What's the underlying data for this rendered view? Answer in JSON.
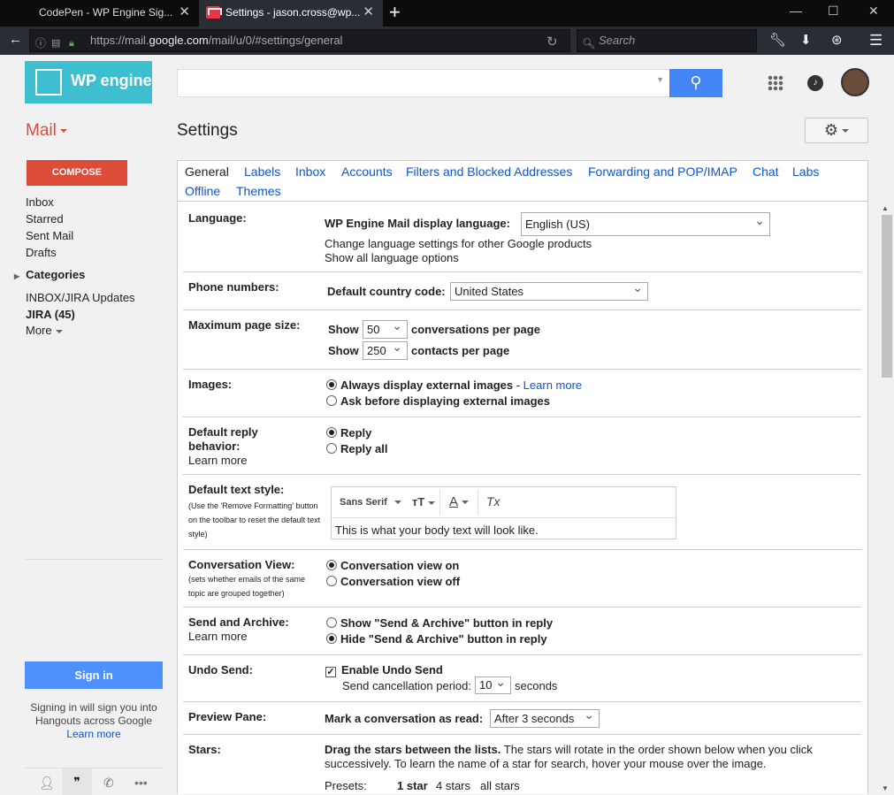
{
  "browser": {
    "tabs": [
      {
        "label": "CodePen - WP Engine Sig...",
        "close": "✕"
      },
      {
        "label": "Settings - jason.cross@wp...",
        "close": "✕"
      }
    ],
    "new_tab": "+",
    "url_prefix": "https://mail.",
    "url_domain": "google.com",
    "url_path": "/mail/u/0/#settings/general",
    "search_placeholder": "Search"
  },
  "header": {
    "logo_text": "WP engine",
    "search_placeholder": ""
  },
  "sidebar": {
    "mail_label": "Mail",
    "compose": "COMPOSE",
    "items": [
      "Inbox",
      "Starred",
      "Sent Mail",
      "Drafts"
    ],
    "categories": "Categories",
    "labels": [
      "INBOX/JIRA Updates",
      "JIRA (45)"
    ],
    "more": "More",
    "sign_in": "Sign in",
    "hangouts_text": "Signing in will sign you into Hangouts across Google",
    "learn_more": "Learn more"
  },
  "settings": {
    "title": "Settings",
    "tabs": [
      "General",
      "Labels",
      "Inbox",
      "Accounts",
      "Filters and Blocked Addresses",
      "Forwarding and POP/IMAP",
      "Chat",
      "Labs",
      "Offline",
      "Themes"
    ],
    "language": {
      "label": "Language:",
      "display_label": "WP Engine Mail display language:",
      "value": "English (US)",
      "link1": "Change language settings for other Google products",
      "link2": "Show all language options"
    },
    "phone": {
      "label": "Phone numbers:",
      "country_label": "Default country code:",
      "value": "United States"
    },
    "page_size": {
      "label": "Maximum page size:",
      "show": "Show",
      "conv_value": "50",
      "conv_text": "conversations per page",
      "contacts_value": "250",
      "contacts_text": "contacts per page"
    },
    "images": {
      "label": "Images:",
      "opt1": "Always display external images",
      "dash": " - ",
      "learn": "Learn more",
      "opt2": "Ask before displaying external images"
    },
    "reply": {
      "label1": "Default reply",
      "label2": "behavior:",
      "learn": "Learn more",
      "opt1": "Reply",
      "opt2": "Reply all"
    },
    "text_style": {
      "label": "Default text style:",
      "sub": "(Use the 'Remove Formatting' button on the toolbar to reset the default text style)",
      "font": "Sans Serif",
      "size_icon": "тT",
      "color_icon": "A",
      "clear_icon": "Tx",
      "preview": "This is what your body text will look like."
    },
    "conversation": {
      "label": "Conversation View:",
      "sub": "(sets whether emails of the same topic are grouped together)",
      "opt1": "Conversation view on",
      "opt2": "Conversation view off"
    },
    "send_archive": {
      "label": "Send and Archive:",
      "learn": "Learn more",
      "opt1": "Show \"Send & Archive\" button in reply",
      "opt2": "Hide \"Send & Archive\" button in reply"
    },
    "undo": {
      "label": "Undo Send:",
      "check_label": "Enable Undo Send",
      "period_label": "Send cancellation period:",
      "value": "10",
      "unit": "seconds"
    },
    "preview": {
      "label": "Preview Pane:",
      "mark_label": "Mark a conversation as read:",
      "value": "After 3 seconds"
    },
    "stars": {
      "label": "Stars:",
      "drag_bold": "Drag the stars between the lists.",
      "drag_rest": "  The stars will rotate in the order shown below when you click successively. To learn the name of a star for search, hover your mouse over the image.",
      "presets": "Presets:",
      "p1": "1 star",
      "p2": "4 stars",
      "p3": "all stars"
    }
  }
}
